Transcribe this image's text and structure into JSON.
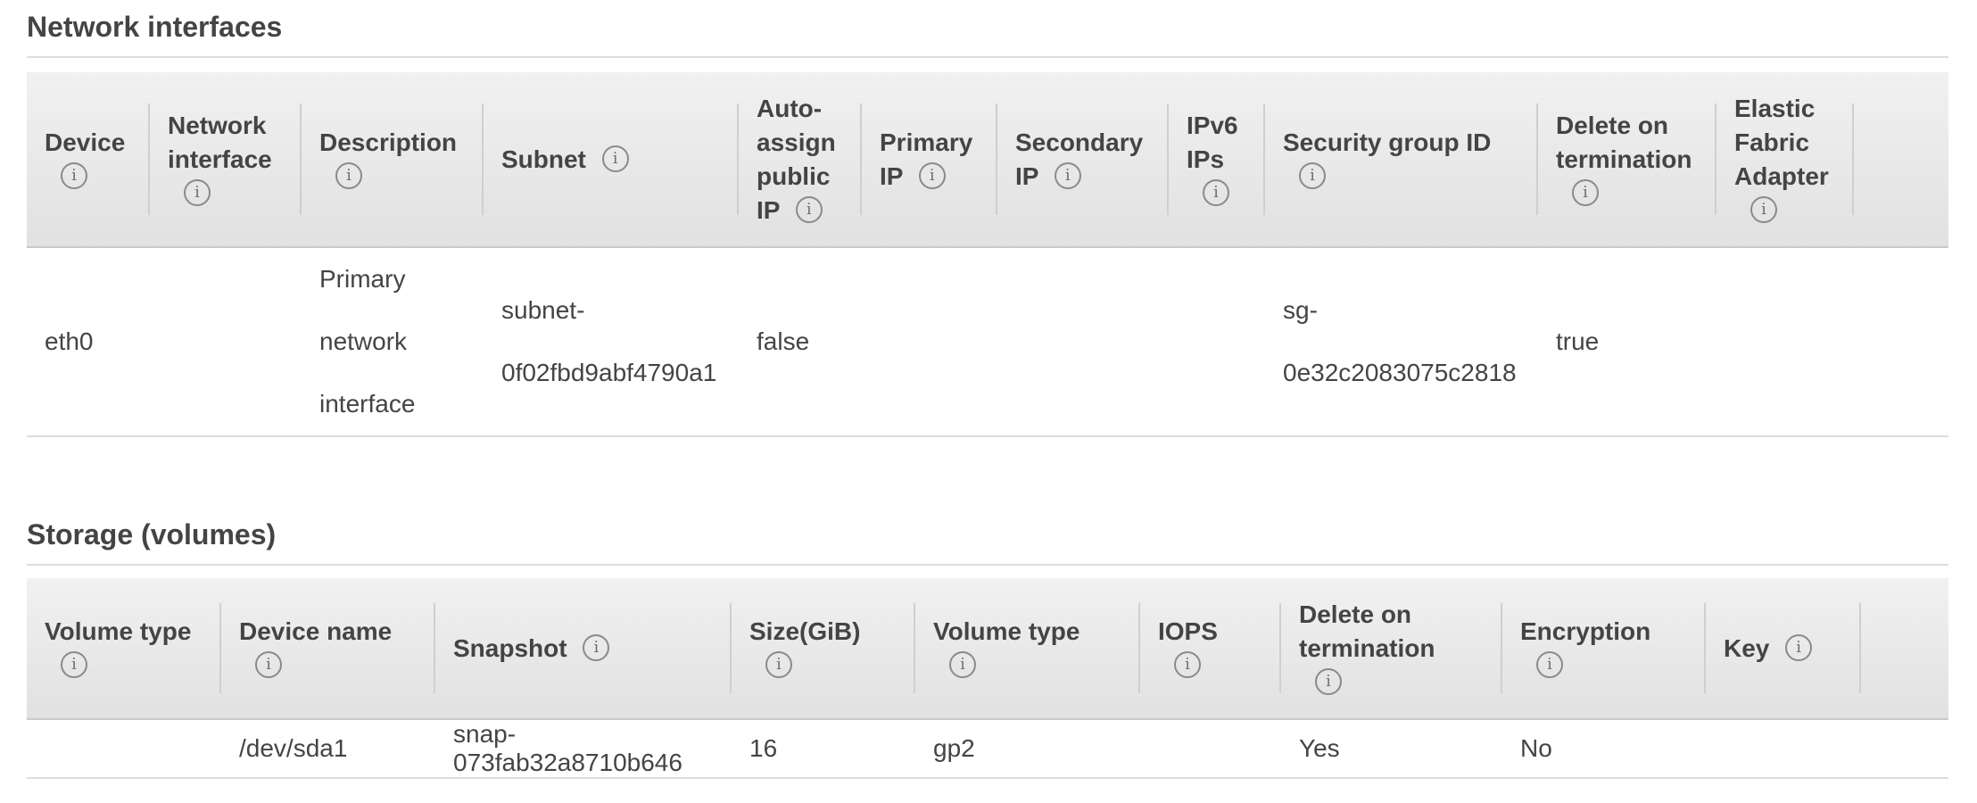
{
  "network_interfaces": {
    "title": "Network interfaces",
    "columns": [
      {
        "label": "Device",
        "info": true
      },
      {
        "label": "Network interface",
        "info": true
      },
      {
        "label": "Description",
        "info": true
      },
      {
        "label": "Subnet",
        "info": true
      },
      {
        "label": "Auto-assign public IP",
        "info": true
      },
      {
        "label": "Primary IP",
        "info": true
      },
      {
        "label": "Secondary IP",
        "info": true
      },
      {
        "label": "IPv6 IPs",
        "info": true
      },
      {
        "label": "Security group ID",
        "info": true
      },
      {
        "label": "Delete on termination",
        "info": true
      },
      {
        "label": "Elastic Fabric Adapter",
        "info": true
      },
      {
        "label": "",
        "info": false
      }
    ],
    "rows": [
      {
        "device": "eth0",
        "network_interface": "",
        "description": "Primary network interface",
        "subnet": "subnet-0f02fbd9abf4790a1",
        "auto_assign_public_ip": "false",
        "primary_ip": "",
        "secondary_ip": "",
        "ipv6_ips": "",
        "security_group_id": "sg-0e32c2083075c2818",
        "delete_on_termination": "true",
        "elastic_fabric_adapter": ""
      }
    ]
  },
  "storage": {
    "title": "Storage (volumes)",
    "columns": [
      {
        "label": "Volume type",
        "info": true
      },
      {
        "label": "Device name",
        "info": true
      },
      {
        "label": "Snapshot",
        "info": true
      },
      {
        "label": "Size(GiB)",
        "info": true
      },
      {
        "label": "Volume type",
        "info": true
      },
      {
        "label": "IOPS",
        "info": true
      },
      {
        "label": "Delete on termination",
        "info": true
      },
      {
        "label": "Encryption",
        "info": true
      },
      {
        "label": "Key",
        "info": true
      },
      {
        "label": "",
        "info": false
      }
    ],
    "rows": [
      {
        "volume_type": "",
        "device_name": "/dev/sda1",
        "snapshot": "snap-073fab32a8710b646",
        "size_gib": "16",
        "volume_type_value": "gp2",
        "iops": "",
        "delete_on_termination": "Yes",
        "encryption": "No",
        "key": ""
      }
    ]
  },
  "icons": {
    "info": "info-icon"
  },
  "colors": {
    "text": "#444444",
    "header_bg": "#e8e8e8",
    "rule": "#dddddd"
  }
}
